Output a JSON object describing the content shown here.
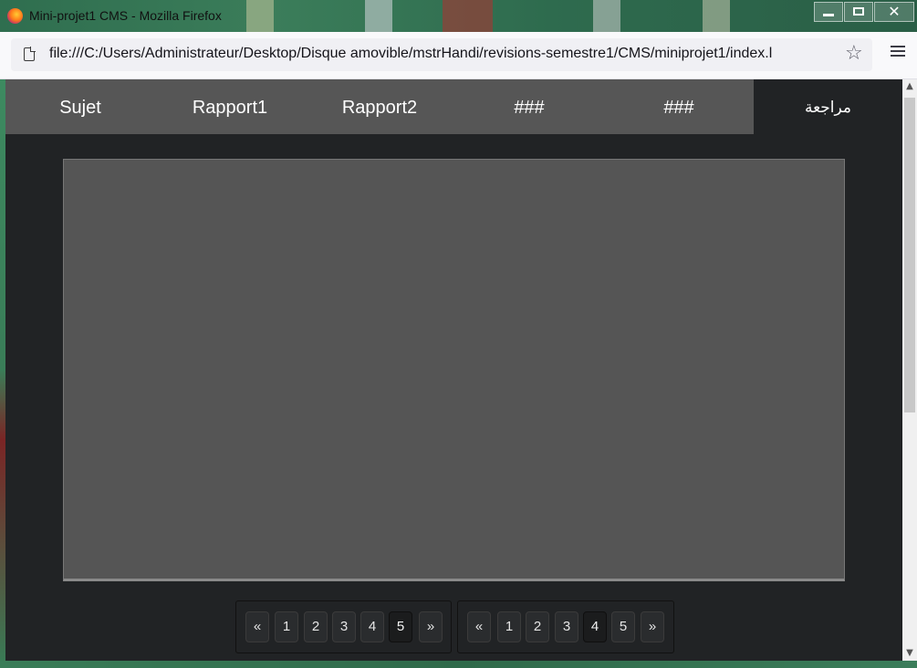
{
  "window": {
    "title": "Mini-projet1 CMS - Mozilla Firefox"
  },
  "toolbar": {
    "url": "file:///C:/Users/Administrateur/Desktop/Disque amovible/mstrHandi/revisions-semestre1/CMS/miniprojet1/index.l"
  },
  "nav": {
    "items": [
      {
        "label": "Sujet"
      },
      {
        "label": "Rapport1"
      },
      {
        "label": "Rapport2"
      },
      {
        "label": "###"
      },
      {
        "label": "###"
      },
      {
        "label": "مراجعة"
      }
    ]
  },
  "pagers": [
    {
      "prev": "«",
      "pages": [
        "1",
        "2",
        "3",
        "4",
        "5"
      ],
      "current": "5",
      "next": "»"
    },
    {
      "prev": "«",
      "pages": [
        "1",
        "2",
        "3",
        "4",
        "5"
      ],
      "current": "4",
      "next": "»"
    }
  ],
  "colors": {
    "page_bg": "#212325",
    "nav_bg": "#565656",
    "content_bg": "#555555"
  }
}
